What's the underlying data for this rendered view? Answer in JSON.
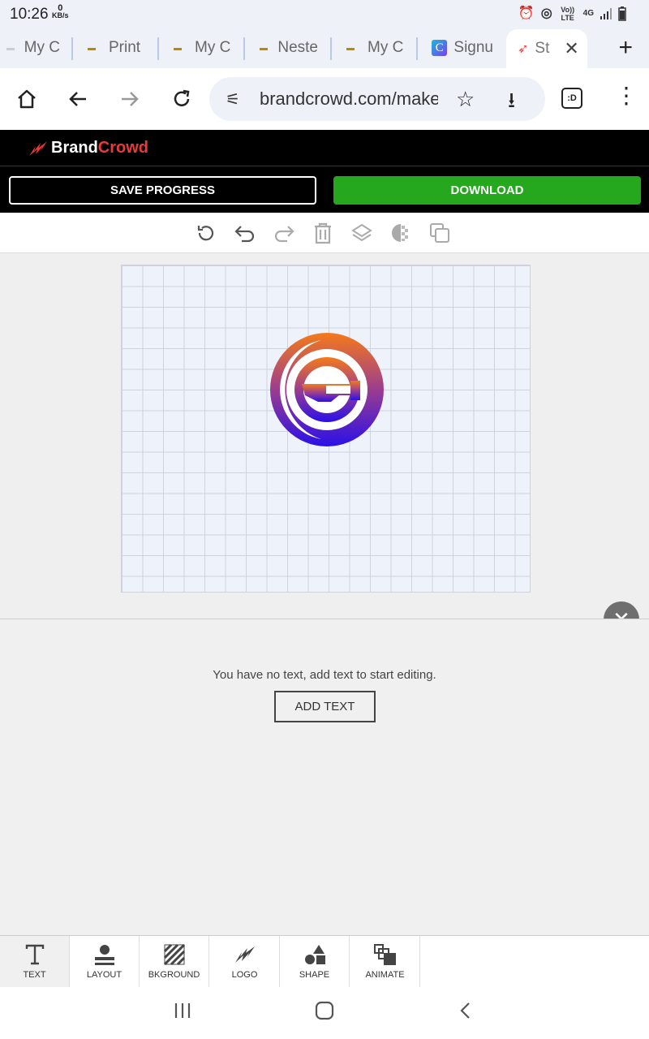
{
  "status": {
    "time": "10:26",
    "kbs_value": "0",
    "kbs_unit": "KB/s",
    "volte": "Vo)) LTE",
    "network": "4G"
  },
  "tabs": [
    {
      "label": "My C"
    },
    {
      "label": "Print"
    },
    {
      "label": "My C"
    },
    {
      "label": "Neste"
    },
    {
      "label": "My C"
    },
    {
      "label": "Signu"
    },
    {
      "label": "St"
    }
  ],
  "browser": {
    "url": "brandcrowd.com/make",
    "badge": ":D"
  },
  "brand": {
    "name_part1": "Brand",
    "name_part2": "Crowd"
  },
  "actions": {
    "save_label": "SAVE PROGRESS",
    "download_label": "DOWNLOAD"
  },
  "panel": {
    "message": "You have no text, add text to start editing.",
    "add_text_label": "ADD TEXT"
  },
  "bottom_nav": [
    {
      "label": "TEXT",
      "icon": "text-icon"
    },
    {
      "label": "LAYOUT",
      "icon": "layout-icon"
    },
    {
      "label": "BKGROUND",
      "icon": "background-icon"
    },
    {
      "label": "LOGO",
      "icon": "logo-icon"
    },
    {
      "label": "SHAPE",
      "icon": "shape-icon"
    },
    {
      "label": "ANIMATE",
      "icon": "animate-icon"
    }
  ],
  "colors": {
    "download": "#25a81e",
    "brand_accent": "#e83a3a",
    "logo_top": "#f47a1a",
    "logo_bottom": "#2a10e8"
  }
}
